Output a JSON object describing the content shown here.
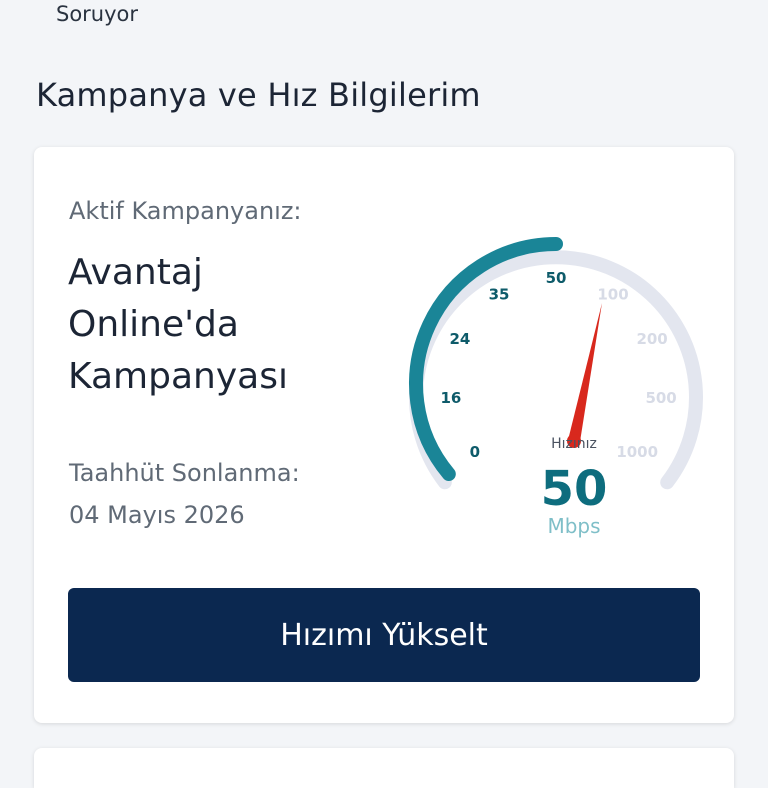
{
  "header": {
    "fragment_text": "Soruyor"
  },
  "section": {
    "title": "Kampanya ve Hız Bilgilerim"
  },
  "campaign": {
    "label": "Aktif Kampanyanız:",
    "name": "Avantaj Online'da Kampanyası",
    "commitment_label": "Taahhüt Sonlanma:",
    "commitment_date": "04 Mayıs 2026"
  },
  "speedometer": {
    "caption": "Hızınız",
    "value": "50",
    "unit": "Mbps",
    "scale": [
      "0",
      "16",
      "24",
      "35",
      "50",
      "100",
      "200",
      "500",
      "1000"
    ],
    "active_index": 4,
    "colors": {
      "active_arc": "#1a8597",
      "inactive_arc": "#e3e6ef",
      "active_label": "#0e5b6a",
      "inactive_label": "#d7dbe6",
      "needle": "#d8281d",
      "value": "#0e6d7e",
      "unit": "#7fbfc8"
    }
  },
  "actions": {
    "upgrade_label": "Hızımı Yükselt"
  }
}
